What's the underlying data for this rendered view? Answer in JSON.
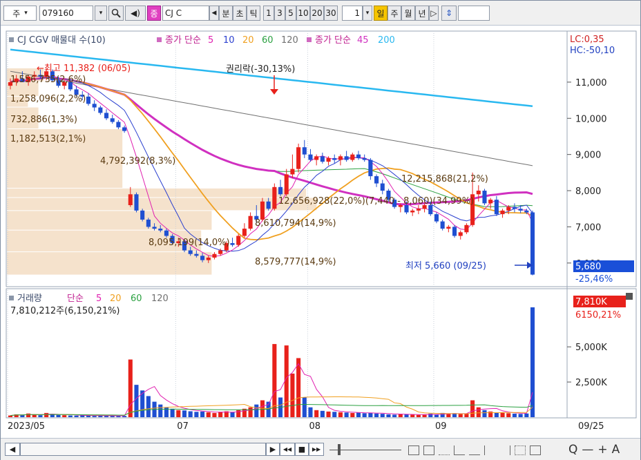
{
  "toolbar": {
    "market_label": "주",
    "code": "079160",
    "name_badge": "종",
    "name_text": "CJ C",
    "period_tabs": [
      "분",
      "초",
      "틱"
    ],
    "intervals": [
      "1",
      "3",
      "5",
      "10",
      "20",
      "30"
    ],
    "interval_select": "1",
    "day_tab": "일",
    "week_tab": "주",
    "month_tab": "월",
    "year_tab": "년",
    "next": "▷",
    "updown": "⇕"
  },
  "price_legend": {
    "title": "CJ CGV 매물대 수(10)",
    "ma_label": "종가 단순",
    "ma_periods": [
      "5",
      "10",
      "20",
      "60",
      "120"
    ],
    "ma2_label": "종가 단순",
    "ma2_periods": [
      "45",
      "200"
    ],
    "lc": "LC:0,35",
    "hc": "HC:-50,10"
  },
  "annotations": {
    "high": "←최고 11,382 (06/05)",
    "rights": "권리락(-30,13%)",
    "low": "최저 5,660 (09/25)",
    "current_price": "5,680",
    "current_change": "-25,46%"
  },
  "volume_profile": [
    {
      "label": "1,556,735(2,6%)"
    },
    {
      "label": "1,258,096(2,2%)"
    },
    {
      "label": "732,886(1,3%)"
    },
    {
      "label": "1,182,513(2,1%)"
    },
    {
      "label": "4,792,392(8,3%)"
    },
    {
      "label": "12,215,868(21,2%)"
    },
    {
      "label": "12,656,928(22,0%)(7,440 - 8,060)(34,99%)"
    },
    {
      "label": "8,610,794(14,9%)"
    },
    {
      "label": "8,095,199(14,0%)"
    },
    {
      "label": "8,579,777(14,9%)"
    }
  ],
  "price_axis": [
    "11,000",
    "10,000",
    "9,000",
    "8,000",
    "7,000",
    "6,000"
  ],
  "volume_legend": {
    "title": "거래량",
    "ma_label": "단순",
    "ma_periods": [
      "5",
      "20",
      "60",
      "120"
    ],
    "info": "7,810,212주(6,150,21%)",
    "badge_value": "7,810K",
    "badge_pct": "6150,21%"
  },
  "volume_axis": [
    "5,000K",
    "2,500K"
  ],
  "x_axis": {
    "labels": [
      "2023/05",
      "07",
      "08",
      "09"
    ],
    "right_label": "09/25"
  },
  "bottom": {
    "left_arrow": "◀",
    "play": "▶",
    "rew": "◀◀",
    "stop": "■",
    "ff": "▶▶",
    "zoom_out": "Q",
    "minus": "—",
    "plus": "+",
    "font_a": "A"
  },
  "colors": {
    "up": "#e8211b",
    "down": "#1f4fd1",
    "ma5": "#e020b0",
    "ma10": "#2a3fcf",
    "ma20": "#f0a020",
    "ma60": "#2aa040",
    "ma120": "#707070",
    "ma45": "#d030c0",
    "ma200": "#29b8f0",
    "profile": "#f5e2cc"
  },
  "chart_data": {
    "type": "candlestick",
    "title": "CJ CGV",
    "x": [
      "05/22",
      "05/23",
      "05/24",
      "05/25",
      "05/26",
      "05/30",
      "05/31",
      "06/01",
      "06/02",
      "06/05",
      "06/07",
      "06/08",
      "06/09",
      "06/12",
      "06/13",
      "06/14",
      "06/15",
      "06/16",
      "06/19",
      "06/20",
      "06/21",
      "06/22",
      "06/23",
      "06/26",
      "06/27",
      "06/28",
      "06/29",
      "06/30",
      "07/03",
      "07/04",
      "07/05",
      "07/06",
      "07/07",
      "07/10",
      "07/11",
      "07/12",
      "07/13",
      "07/14",
      "07/17",
      "07/18",
      "07/19",
      "07/20",
      "07/21",
      "07/24",
      "07/25",
      "07/26",
      "07/27",
      "07/28",
      "07/31",
      "08/01",
      "08/02",
      "08/03",
      "08/04",
      "08/07",
      "08/08",
      "08/09",
      "08/10",
      "08/11",
      "08/14",
      "08/16",
      "08/17",
      "08/18",
      "08/21",
      "08/22",
      "08/23",
      "08/24",
      "08/25",
      "08/28",
      "08/29",
      "08/30",
      "08/31",
      "09/01",
      "09/04",
      "09/05",
      "09/06",
      "09/07",
      "09/08",
      "09/11",
      "09/12",
      "09/13",
      "09/14",
      "09/15",
      "09/18",
      "09/19",
      "09/20",
      "09/21",
      "09/22",
      "09/25"
    ],
    "ohlc": [
      [
        10900,
        11100,
        10800,
        11000
      ],
      [
        11000,
        11200,
        10900,
        11100
      ],
      [
        11100,
        11300,
        11000,
        11000
      ],
      [
        11000,
        11200,
        10900,
        11150
      ],
      [
        11150,
        11300,
        11050,
        11200
      ],
      [
        11200,
        11350,
        11100,
        11150
      ],
      [
        11150,
        11382,
        11050,
        11300
      ],
      [
        11300,
        11350,
        11000,
        11050
      ],
      [
        11050,
        11150,
        10850,
        10900
      ],
      [
        10900,
        11050,
        10800,
        11000
      ],
      [
        11000,
        11050,
        10750,
        10800
      ],
      [
        10800,
        10900,
        10600,
        10650
      ],
      [
        10650,
        10750,
        10500,
        10600
      ],
      [
        10600,
        10700,
        10350,
        10400
      ],
      [
        10400,
        10500,
        10200,
        10300
      ],
      [
        10300,
        10350,
        10100,
        10150
      ],
      [
        10150,
        10250,
        9950,
        10000
      ],
      [
        10000,
        10100,
        9850,
        9900
      ],
      [
        9900,
        9950,
        9700,
        9750
      ],
      [
        9750,
        9800,
        9600,
        9650
      ],
      [
        7600,
        8100,
        7550,
        7900
      ],
      [
        7900,
        7950,
        7400,
        7450
      ],
      [
        7450,
        7500,
        7150,
        7200
      ],
      [
        7200,
        7250,
        6950,
        7000
      ],
      [
        7000,
        7100,
        6900,
        6950
      ],
      [
        6950,
        7050,
        6850,
        6900
      ],
      [
        6900,
        6950,
        6700,
        6750
      ],
      [
        6750,
        6800,
        6500,
        6550
      ],
      [
        6550,
        6700,
        6450,
        6600
      ],
      [
        6600,
        6650,
        6300,
        6350
      ],
      [
        6350,
        6450,
        6200,
        6250
      ],
      [
        6250,
        6350,
        6150,
        6200
      ],
      [
        6200,
        6280,
        6020,
        6080
      ],
      [
        6080,
        6200,
        6000,
        6150
      ],
      [
        6150,
        6300,
        6100,
        6250
      ],
      [
        6250,
        6400,
        6200,
        6350
      ],
      [
        6350,
        6600,
        6300,
        6550
      ],
      [
        6550,
        6700,
        6450,
        6500
      ],
      [
        6500,
        6800,
        6450,
        6750
      ],
      [
        6750,
        7100,
        6700,
        6950
      ],
      [
        6950,
        7400,
        6900,
        7300
      ],
      [
        7300,
        7600,
        7100,
        7200
      ],
      [
        7200,
        7800,
        7150,
        7700
      ],
      [
        7700,
        7800,
        7450,
        7500
      ],
      [
        7500,
        8200,
        7450,
        8100
      ],
      [
        8100,
        8300,
        7850,
        7900
      ],
      [
        7900,
        8600,
        7850,
        8450
      ],
      [
        8450,
        9000,
        8350,
        8600
      ],
      [
        8600,
        9300,
        8500,
        9200
      ],
      [
        9200,
        9400,
        8900,
        9000
      ],
      [
        9000,
        9150,
        8800,
        8850
      ],
      [
        8850,
        9000,
        8700,
        8950
      ],
      [
        8950,
        9050,
        8750,
        8800
      ],
      [
        8800,
        8950,
        8700,
        8900
      ],
      [
        8900,
        9000,
        8750,
        8850
      ],
      [
        8850,
        9000,
        8700,
        8950
      ],
      [
        8950,
        9100,
        8800,
        8850
      ],
      [
        8850,
        9050,
        8800,
        9000
      ],
      [
        9000,
        9100,
        8850,
        8900
      ],
      [
        8900,
        9000,
        8800,
        8850
      ],
      [
        8850,
        8900,
        8300,
        8400
      ],
      [
        8400,
        8450,
        8100,
        8200
      ],
      [
        8200,
        8300,
        7900,
        8000
      ],
      [
        8000,
        8050,
        7700,
        7750
      ],
      [
        7750,
        7800,
        7500,
        7550
      ],
      [
        7550,
        7650,
        7400,
        7600
      ],
      [
        7600,
        7700,
        7350,
        7400
      ],
      [
        7400,
        7500,
        7300,
        7450
      ],
      [
        7450,
        7600,
        7350,
        7500
      ],
      [
        7500,
        7650,
        7400,
        7600
      ],
      [
        7600,
        7700,
        7300,
        7350
      ],
      [
        7350,
        7400,
        7100,
        7150
      ],
      [
        7150,
        7200,
        6900,
        6950
      ],
      [
        6950,
        7050,
        6850,
        7000
      ],
      [
        7000,
        7050,
        6700,
        6750
      ],
      [
        6750,
        6900,
        6650,
        6850
      ],
      [
        6850,
        7100,
        6800,
        7050
      ],
      [
        7050,
        8500,
        7000,
        7900
      ],
      [
        7900,
        8150,
        7700,
        8000
      ],
      [
        8000,
        8050,
        7600,
        7650
      ],
      [
        7650,
        7800,
        7500,
        7750
      ],
      [
        7750,
        7850,
        7300,
        7350
      ],
      [
        7350,
        7500,
        7250,
        7450
      ],
      [
        7450,
        7600,
        7350,
        7550
      ],
      [
        7550,
        7650,
        7400,
        7500
      ],
      [
        7500,
        7600,
        7380,
        7450
      ],
      [
        7450,
        7500,
        7350,
        7400
      ],
      [
        7400,
        7450,
        5660,
        5680
      ]
    ],
    "volume_k": [
      120,
      200,
      150,
      260,
      180,
      140,
      300,
      220,
      160,
      140,
      120,
      110,
      130,
      100,
      90,
      110,
      95,
      85,
      80,
      90,
      4100,
      2300,
      1900,
      1500,
      1100,
      900,
      700,
      600,
      500,
      480,
      420,
      380,
      400,
      350,
      300,
      380,
      420,
      350,
      500,
      600,
      700,
      900,
      1200,
      1100,
      5200,
      1400,
      5100,
      3100,
      4200,
      1400,
      700,
      500,
      450,
      400,
      380,
      350,
      330,
      300,
      320,
      280,
      300,
      260,
      240,
      200,
      180,
      220,
      200,
      180,
      160,
      170,
      250,
      200,
      300,
      260,
      280,
      220,
      250,
      1200,
      700,
      500,
      400,
      300,
      350,
      280,
      250,
      230,
      260,
      7810
    ],
    "ylim": [
      5500,
      11800
    ],
    "volume_ylim_k": [
      0,
      8200
    ]
  }
}
